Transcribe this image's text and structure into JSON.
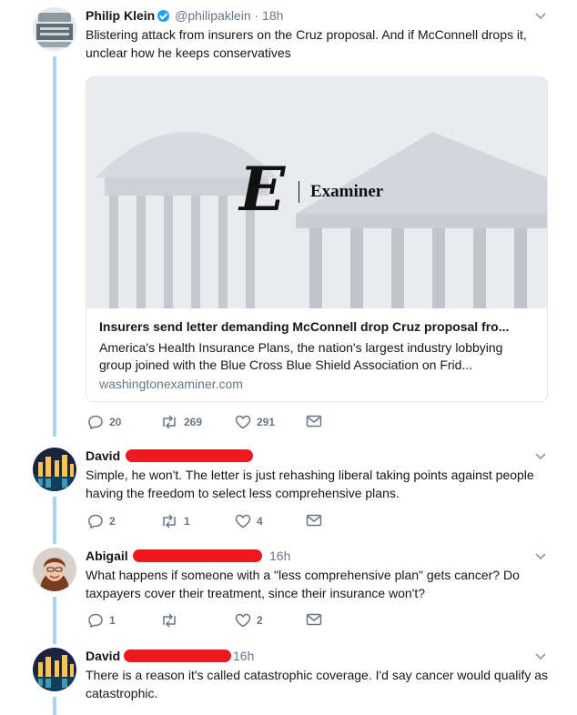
{
  "tweets": [
    {
      "author": "Philip Klein",
      "handle": "@philipaklein",
      "time": "18h",
      "text": "Blistering attack from insurers on the Cruz proposal. And if McConnell drops it, unclear how he keeps conservatives",
      "card": {
        "brand": "Examiner",
        "title": "Insurers send letter demanding McConnell drop Cruz proposal fro...",
        "description": "America's Health Insurance Plans, the nation's largest industry lobbying group joined with the Blue Cross Blue Shield Association on Frid...",
        "domain": "washingtonexaminer.com"
      },
      "replies": "20",
      "retweets": "269",
      "likes": "291"
    },
    {
      "author": "David",
      "time": "",
      "text": "Simple, he won't. The letter is just rehashing liberal taking points against people having the freedom to select less comprehensive plans.",
      "replies": "2",
      "retweets": "1",
      "likes": "4"
    },
    {
      "author": "Abigail",
      "time": "16h",
      "text": "What happens if someone with a \"less comprehensive plan\" gets cancer? Do taxpayers cover their treatment, since their insurance won't?",
      "replies": "1",
      "retweets": "",
      "likes": "2"
    },
    {
      "author": "David",
      "time": "16h",
      "text": "There is a reason it's called catastrophic coverage. I'd say cancer would qualify as catastrophic.",
      "replies": "",
      "retweets": "",
      "likes": ""
    }
  ],
  "colors": {
    "thread": "#a8d4f2",
    "redaction": "#f0181f",
    "verified": "#1da1f2",
    "muted": "#657786"
  }
}
